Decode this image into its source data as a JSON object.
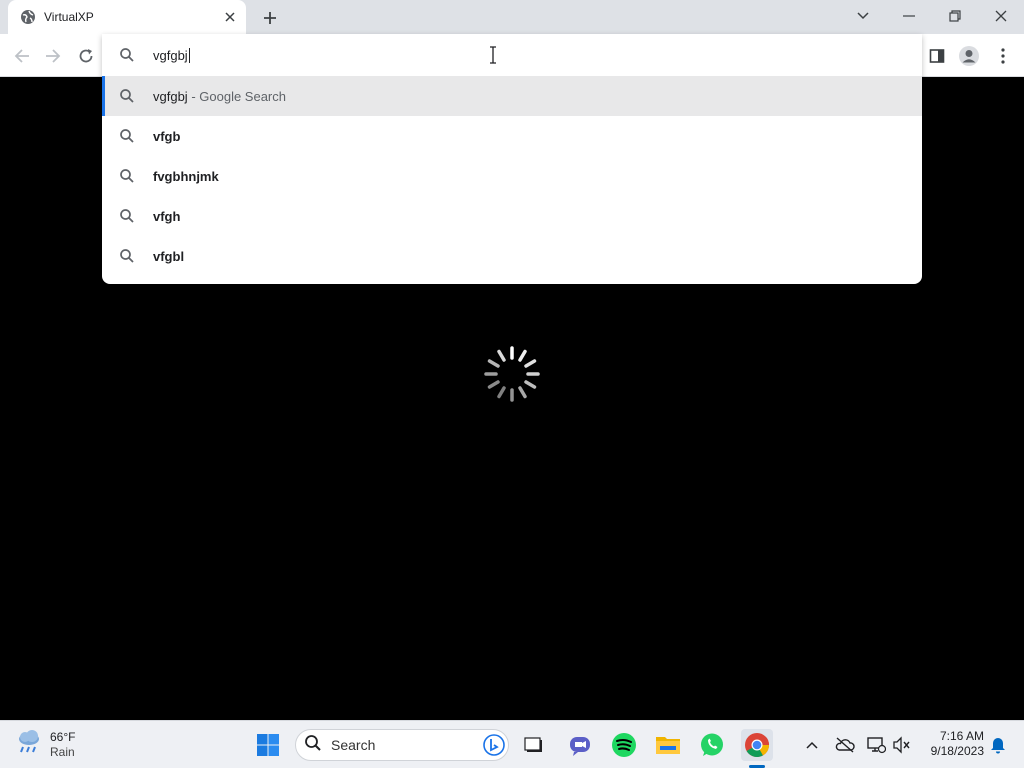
{
  "browser": {
    "tab_title": "VirtualXP",
    "tab_favicon": "globe-icon"
  },
  "omnibox": {
    "input_value": "vgfgbj",
    "suggestions": [
      {
        "text": "vgfgbj",
        "suffix": "- Google Search",
        "selected": true
      },
      {
        "text": "vfgb"
      },
      {
        "text": "fvgbhnjmk"
      },
      {
        "text": "vfgh"
      },
      {
        "text": "vfgbl"
      }
    ]
  },
  "taskbar": {
    "weather_temp": "66°F",
    "weather_cond": "Rain",
    "search_label": "Search",
    "time": "7:16 AM",
    "date": "9/18/2023"
  },
  "colors": {
    "accent": "#1a73e8",
    "page_background": "#000000",
    "taskbar": "#eef0f4"
  }
}
